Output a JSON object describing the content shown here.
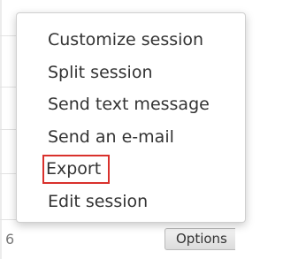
{
  "background": {
    "row_number": "6",
    "options_button": "Options"
  },
  "context_menu": {
    "items": [
      {
        "label": "Customize session"
      },
      {
        "label": "Split session"
      },
      {
        "label": "Send text message"
      },
      {
        "label": "Send an e-mail"
      },
      {
        "label": "Export",
        "highlighted": true
      },
      {
        "label": "Edit session"
      }
    ]
  },
  "colors": {
    "highlight_border": "#d9312c",
    "text": "#333333"
  }
}
